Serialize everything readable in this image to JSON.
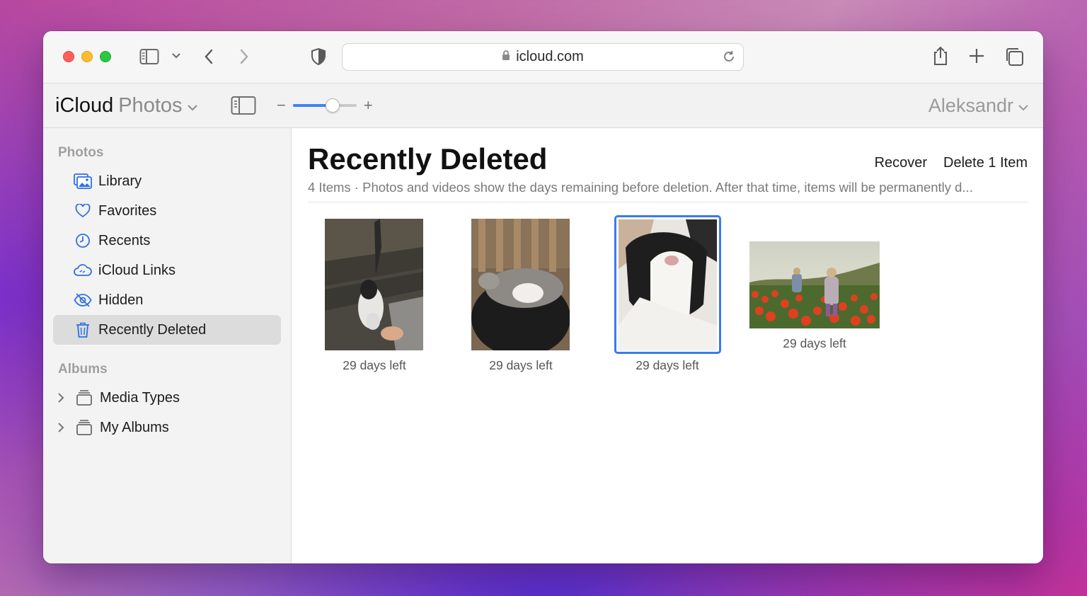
{
  "browser": {
    "url": "icloud.com"
  },
  "app": {
    "brand": "iCloud",
    "brand_sub": "Photos",
    "user": "Aleksandr",
    "zoom": {
      "minus": "−",
      "plus": "+",
      "level": 0.62
    }
  },
  "sidebar": {
    "photos_header": "Photos",
    "items": [
      {
        "label": "Library",
        "icon": "library-icon"
      },
      {
        "label": "Favorites",
        "icon": "heart-icon"
      },
      {
        "label": "Recents",
        "icon": "clock-icon"
      },
      {
        "label": "iCloud Links",
        "icon": "cloud-link-icon"
      },
      {
        "label": "Hidden",
        "icon": "eye-slash-icon"
      },
      {
        "label": "Recently Deleted",
        "icon": "trash-icon",
        "active": true
      }
    ],
    "albums_header": "Albums",
    "albums": [
      {
        "label": "Media Types",
        "icon": "album-stack-icon"
      },
      {
        "label": "My Albums",
        "icon": "album-stack-icon"
      }
    ]
  },
  "main": {
    "title": "Recently Deleted",
    "recover_label": "Recover",
    "delete_label": "Delete 1 Item",
    "subtitle": "4 Items  ·  Photos and videos show the days remaining before deletion. After that time, items will be permanently d...",
    "photos": [
      {
        "label": "29 days left",
        "selected": false
      },
      {
        "label": "29 days left",
        "selected": false
      },
      {
        "label": "29 days left",
        "selected": true
      },
      {
        "label": "29 days left",
        "selected": false
      }
    ]
  },
  "colors": {
    "accent": "#3a7af0",
    "selection_bg": "#dcdcdc"
  }
}
